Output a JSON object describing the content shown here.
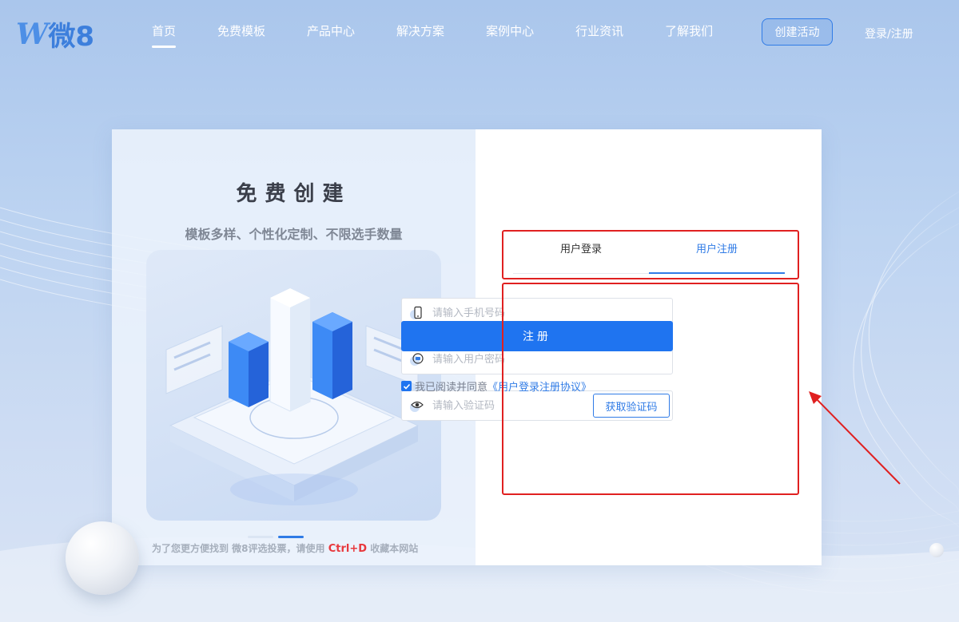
{
  "header": {
    "logo_glyph": "W",
    "logo_text": "微8",
    "nav": [
      {
        "label": "首页",
        "active": true
      },
      {
        "label": "免费模板",
        "active": false
      },
      {
        "label": "产品中心",
        "active": false
      },
      {
        "label": "解决方案",
        "active": false
      },
      {
        "label": "案例中心",
        "active": false
      },
      {
        "label": "行业资讯",
        "active": false
      },
      {
        "label": "了解我们",
        "active": false
      }
    ],
    "create_button": "创建活动",
    "login_link": "登录/注册"
  },
  "promo": {
    "title": "免费创建",
    "subtitle": "模板多样、个性化定制、不限选手数量",
    "tip_before": "为了您更方便找到 微8评选投票，请使用",
    "tip_hotkey": "Ctrl+D",
    "tip_after": "收藏本网站"
  },
  "auth": {
    "tabs": [
      {
        "label": "用户登录",
        "active": false
      },
      {
        "label": "用户注册",
        "active": true
      }
    ],
    "phone_placeholder": "请输入手机号码",
    "password_placeholder": "请输入用户密码",
    "code_placeholder": "请输入验证码",
    "get_code_button": "获取验证码",
    "submit_button": "注册",
    "agree_checked": true,
    "agree_text": "我已阅读并同意",
    "agree_link": "《用户登录注册协议》"
  },
  "colors": {
    "accent": "#1f74f0",
    "annotation": "#e02020"
  }
}
